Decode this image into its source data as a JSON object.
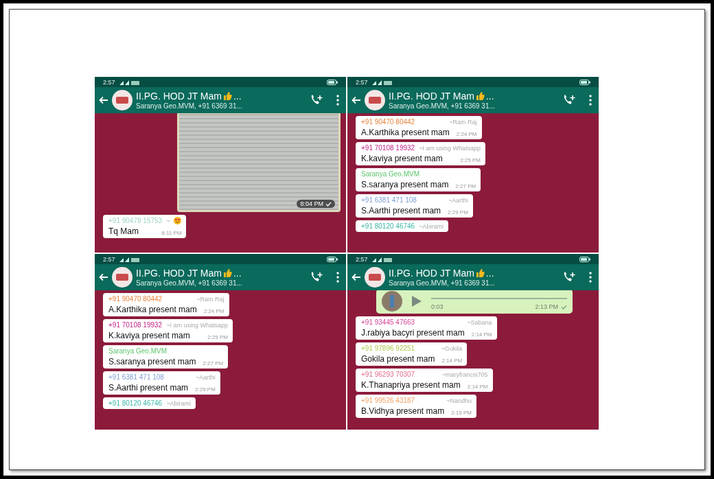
{
  "panels": [
    {
      "status_time": "2:57",
      "title": "II.PG. HOD JT Mam",
      "title_more": "...",
      "subtitle": "Saranya Geo.MVM, +91 6369 31...",
      "messages": [
        {
          "kind": "document",
          "time": "8:04 PM",
          "ticked": true
        },
        {
          "kind": "text",
          "sender": "+91 90478 15753",
          "color": "#9fd3c7",
          "alias": "~",
          "alias_emoji": true,
          "text": "Tq Mam",
          "time": "8:11 PM"
        }
      ]
    },
    {
      "status_time": "2:57",
      "title": "II.PG. HOD JT Mam",
      "title_more": "...",
      "subtitle": "Saranya Geo.MVM, +91 6369 31...",
      "messages": [
        {
          "kind": "text",
          "sender": "+91 90470 80442",
          "color": "#e8843c",
          "alias": "~Ram Raj",
          "text": "A.Karthika present mam",
          "time": "2:24 PM"
        },
        {
          "kind": "text",
          "sender": "+91 70108 19932",
          "color": "#c2258a",
          "alias": "~I am using Whatsapp",
          "text": "K.kaviya present mam",
          "time": "2:25 PM"
        },
        {
          "kind": "text",
          "sender": "Saranya Geo.MVM",
          "color": "#5cc46a",
          "text": "S.saranya present mam",
          "time": "2:27 PM"
        },
        {
          "kind": "text",
          "sender": "+91 6381 471 108",
          "color": "#7f9fd6",
          "alias": "~Aarthi",
          "text": "S.Aarthi present mam",
          "time": "2:29 PM"
        },
        {
          "kind": "text",
          "sender": "+91 80120 46746",
          "color": "#3bb5a6",
          "alias": "~Abirami"
        }
      ]
    },
    {
      "status_time": "2:57",
      "title": "II.PG. HOD JT Mam",
      "title_more": "...",
      "subtitle": "Saranya Geo.MVM, +91 6369 31...",
      "messages": [
        {
          "kind": "text",
          "sender": "+91 90470 80442",
          "color": "#e8843c",
          "alias": "~Ram Raj",
          "text": "A.Karthika present mam",
          "time": "2:24 PM"
        },
        {
          "kind": "text",
          "sender": "+91 70108 19932",
          "color": "#c2258a",
          "alias": "~I am using Whatsapp",
          "text": "K.kaviya present mam",
          "time": "2:25 PM"
        },
        {
          "kind": "text",
          "sender": "Saranya Geo.MVM",
          "color": "#5cc46a",
          "text": "S.saranya present mam",
          "time": "2:27 PM"
        },
        {
          "kind": "text",
          "sender": "+91 6381 471 108",
          "color": "#7f9fd6",
          "alias": "~Aarthi",
          "text": "S.Aarthi present mam",
          "time": "2:29 PM"
        },
        {
          "kind": "text",
          "sender": "+91 80120 46746",
          "color": "#3bb5a6",
          "alias": "~Abirami"
        }
      ]
    },
    {
      "status_time": "2:57",
      "title": "II.PG. HOD JT Mam",
      "title_more": "...",
      "subtitle": "Saranya Geo.MVM, +91 6369 31...",
      "messages": [
        {
          "kind": "voice",
          "duration": "0:03",
          "time": "2:13 PM",
          "ticked": true
        },
        {
          "kind": "text",
          "sender": "+91 93445 47663",
          "color": "#d6449a",
          "alias": "~Sabana",
          "text": "J.rabiya bacyri present mam",
          "time": "2:14 PM"
        },
        {
          "kind": "text",
          "sender": "+91 97896 92251",
          "color": "#a8c94a",
          "alias": "~Gokila",
          "text": "Gokila present mam",
          "time": "2:14 PM"
        },
        {
          "kind": "text",
          "sender": "+91 96293 70307",
          "color": "#e26a8a",
          "alias": "~maryfrancis705",
          "text": "K.Thanapriya present mam",
          "time": "2:14 PM"
        },
        {
          "kind": "text",
          "sender": "+91 99526 43187",
          "color": "#f0a060",
          "alias": "~Nandhu",
          "text": "B.Vidhya present mam",
          "time": "2:15 PM"
        }
      ]
    }
  ]
}
